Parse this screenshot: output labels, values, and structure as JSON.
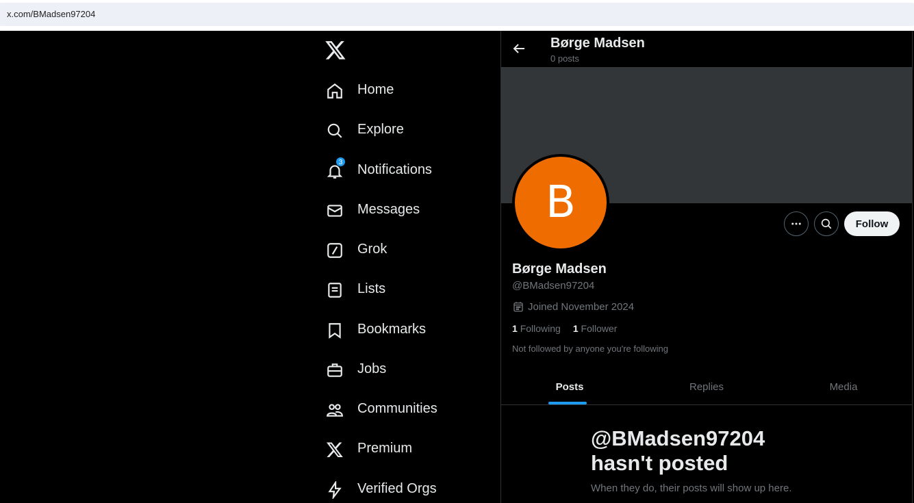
{
  "browser": {
    "url": "x.com/BMadsen97204"
  },
  "nav": {
    "items": [
      {
        "label": "Home",
        "icon": "home-icon"
      },
      {
        "label": "Explore",
        "icon": "search-icon"
      },
      {
        "label": "Notifications",
        "icon": "bell-icon",
        "badge": "3"
      },
      {
        "label": "Messages",
        "icon": "envelope-icon"
      },
      {
        "label": "Grok",
        "icon": "grok-icon"
      },
      {
        "label": "Lists",
        "icon": "list-icon"
      },
      {
        "label": "Bookmarks",
        "icon": "bookmark-icon"
      },
      {
        "label": "Jobs",
        "icon": "briefcase-icon"
      },
      {
        "label": "Communities",
        "icon": "people-icon"
      },
      {
        "label": "Premium",
        "icon": "x-logo-icon"
      },
      {
        "label": "Verified Orgs",
        "icon": "lightning-icon"
      }
    ]
  },
  "header": {
    "name": "Børge Madsen",
    "posts": "0 posts"
  },
  "profile": {
    "avatar_letter": "B",
    "avatar_color": "#ef6c00",
    "name": "Børge Madsen",
    "handle": "@BMadsen97204",
    "joined": "Joined November 2024",
    "following_count": "1",
    "following_label": "Following",
    "follower_count": "1",
    "follower_label": "Follower",
    "note": "Not followed by anyone you're following",
    "follow_label": "Follow"
  },
  "tabs": [
    "Posts",
    "Replies",
    "Media"
  ],
  "empty": {
    "title": "@BMadsen97204 hasn't posted",
    "subtitle": "When they do, their posts will show up here."
  },
  "colors": {
    "accent": "#1d9bf0",
    "banner": "#333639",
    "background": "#000000"
  }
}
